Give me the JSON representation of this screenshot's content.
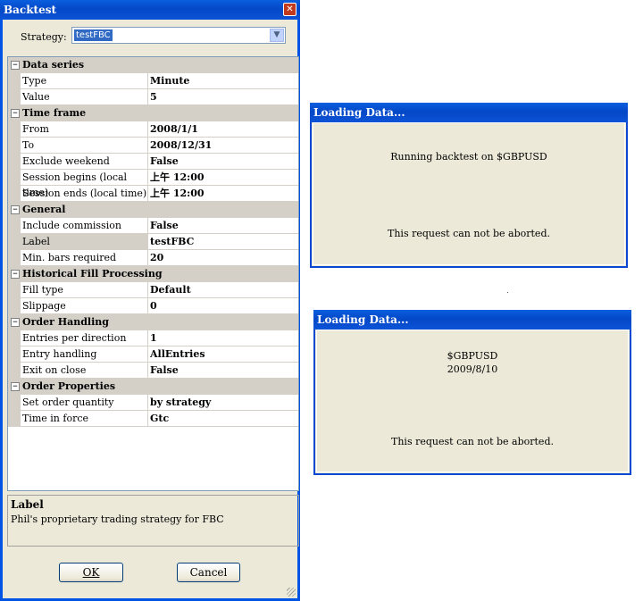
{
  "backtest": {
    "title": "Backtest",
    "close_glyph": "✕",
    "strategy_label": "Strategy:",
    "strategy_value": "testFBC",
    "strategy_dropdown_glyph": "▼",
    "categories": [
      {
        "name": "Data series",
        "toggle": "−",
        "props": [
          {
            "name": "Type",
            "value": "Minute"
          },
          {
            "name": "Value",
            "value": "5"
          }
        ]
      },
      {
        "name": "Time frame",
        "toggle": "−",
        "props": [
          {
            "name": "From",
            "value": "2008/1/1"
          },
          {
            "name": "To",
            "value": "2008/12/31"
          },
          {
            "name": "Exclude weekend",
            "value": "False"
          },
          {
            "name": "Session begins (local time)",
            "value": "上午 12:00"
          },
          {
            "name": "Session ends (local time)",
            "value": "上午 12:00"
          }
        ]
      },
      {
        "name": "General",
        "toggle": "−",
        "props": [
          {
            "name": "Include commission",
            "value": "False"
          },
          {
            "name": "Label",
            "value": "testFBC",
            "selected": true
          },
          {
            "name": "Min. bars required",
            "value": "20"
          }
        ]
      },
      {
        "name": "Historical Fill Processing",
        "toggle": "−",
        "props": [
          {
            "name": "Fill type",
            "value": "Default"
          },
          {
            "name": "Slippage",
            "value": "0"
          }
        ]
      },
      {
        "name": "Order Handling",
        "toggle": "−",
        "props": [
          {
            "name": "Entries per direction",
            "value": "1"
          },
          {
            "name": "Entry handling",
            "value": "AllEntries"
          },
          {
            "name": "Exit on close",
            "value": "False"
          }
        ]
      },
      {
        "name": "Order Properties",
        "toggle": "−",
        "props": [
          {
            "name": "Set order quantity",
            "value": "by strategy"
          },
          {
            "name": "Time in force",
            "value": "Gtc"
          }
        ]
      }
    ],
    "help_title": "Label",
    "help_desc": "Phil's proprietary trading strategy for FBC",
    "ok_label": "OK",
    "cancel_label": "Cancel"
  },
  "loading1": {
    "title": "Loading Data...",
    "line1": "Running backtest on $GBPUSD",
    "note": "This request can not be aborted."
  },
  "loading2": {
    "title": "Loading Data...",
    "line1": "$GBPUSD",
    "line2": "2009/8/10",
    "note": "This request can not be aborted."
  },
  "colors": {
    "titlebar": "#0448c7",
    "dialog_bg": "#ece9d8",
    "category_bg": "#d4d0c8",
    "selection": "#316ac5"
  }
}
